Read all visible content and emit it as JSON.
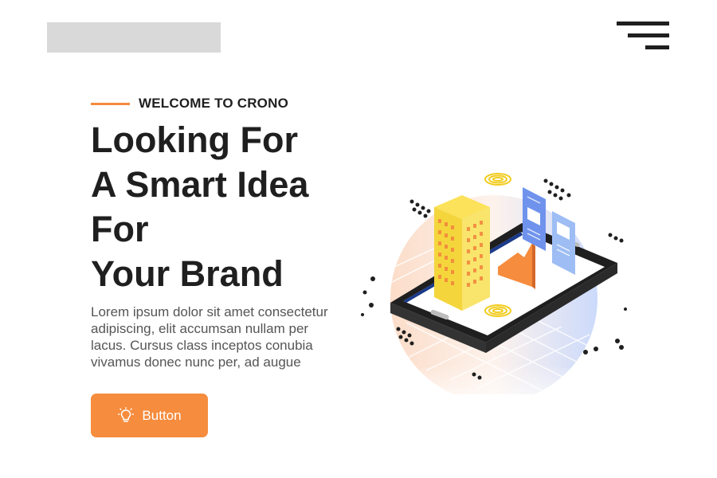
{
  "header": {
    "menu_icon": "hamburger-menu-icon"
  },
  "hero": {
    "eyebrow": "WELCOME TO CRONO",
    "headline": [
      "Looking For",
      "A Smart Idea",
      "For",
      "Your Brand"
    ],
    "body_lines": [
      "Lorem ipsum dolor sit amet consectetur",
      "adipiscing, elit accumsan nullam per",
      "lacus. Cursus class inceptos conubia",
      "vivamus donec nunc per, ad augue"
    ],
    "button_label": "Button",
    "button_icon": "lightbulb-icon"
  },
  "colors": {
    "accent": "#f68c3d",
    "text_dark": "#1f1f1f",
    "text_muted": "#555555",
    "placeholder": "#d9d9d9"
  }
}
